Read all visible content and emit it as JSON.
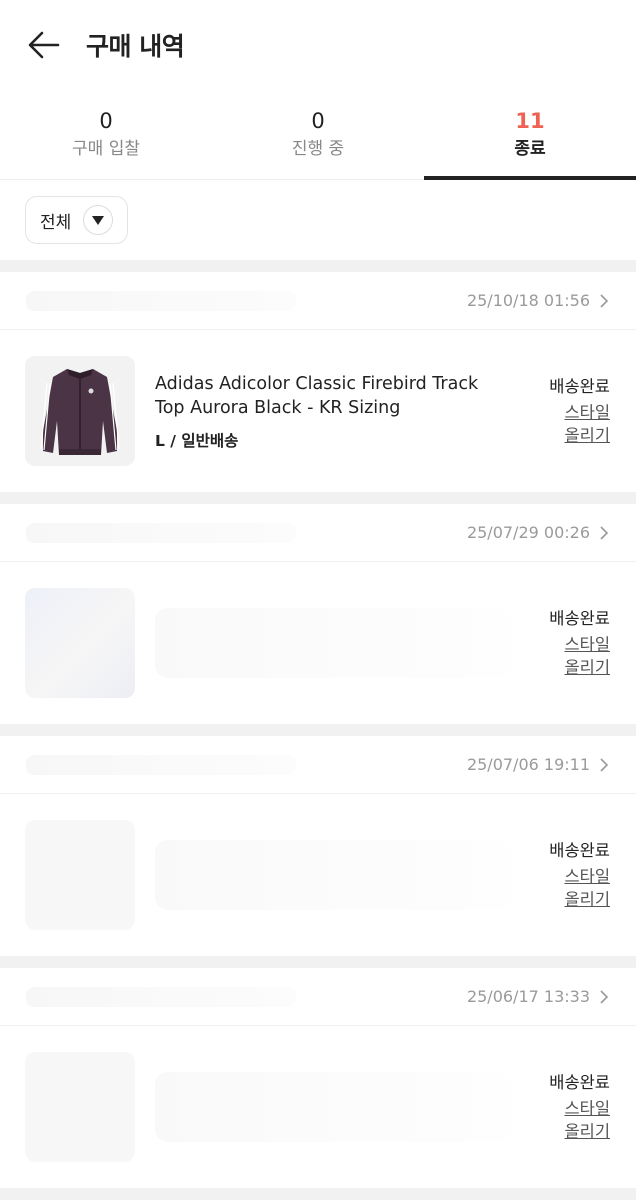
{
  "header": {
    "title": "구매 내역"
  },
  "tabs": [
    {
      "count": "0",
      "label": "구매 입찰"
    },
    {
      "count": "0",
      "label": "진행 중"
    },
    {
      "count": "11",
      "label": "종료"
    }
  ],
  "filter": {
    "label": "전체"
  },
  "orders": [
    {
      "date": "25/10/18 01:56",
      "product_name": "Adidas Adicolor Classic Firebird Track Top Aurora Black - KR Sizing",
      "option": "L / 일반배송",
      "status": "배송완료",
      "style_link_line1": "스타일",
      "style_link_line2": "올리기"
    },
    {
      "date": "25/07/29 00:26",
      "status": "배송완료",
      "style_link_line1": "스타일",
      "style_link_line2": "올리기"
    },
    {
      "date": "25/07/06 19:11",
      "status": "배송완료",
      "style_link_line1": "스타일",
      "style_link_line2": "올리기"
    },
    {
      "date": "25/06/17 13:33",
      "status": "배송완료",
      "style_link_line1": "스타일",
      "style_link_line2": "올리기"
    }
  ],
  "colors": {
    "active_count": "#ef6253",
    "text": "#222222",
    "muted": "#9a9a9a"
  }
}
